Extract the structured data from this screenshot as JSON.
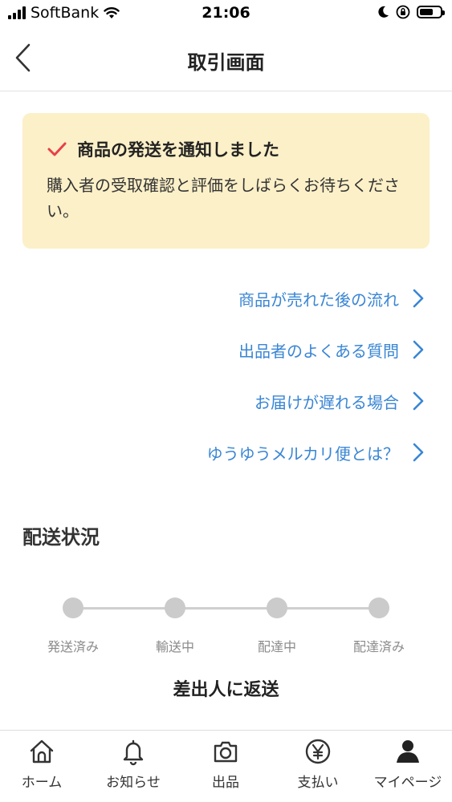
{
  "status_bar": {
    "carrier": "SoftBank",
    "time": "21:06"
  },
  "header": {
    "title": "取引画面"
  },
  "notice": {
    "title": "商品の発送を通知しました",
    "body": "購入者の受取確認と評価をしばらくお待ちください。"
  },
  "links": [
    {
      "label": "商品が売れた後の流れ"
    },
    {
      "label": "出品者のよくある質問"
    },
    {
      "label": "お届けが遅れる場合"
    },
    {
      "label": "ゆうゆうメルカリ便とは？"
    }
  ],
  "delivery": {
    "title": "配送状況",
    "steps": [
      {
        "label": "発送済み"
      },
      {
        "label": "輸送中"
      },
      {
        "label": "配達中"
      },
      {
        "label": "配達済み"
      }
    ],
    "return_text": "差出人に返送"
  },
  "tabbar": {
    "items": [
      {
        "label": "ホーム",
        "icon": "home-icon"
      },
      {
        "label": "お知らせ",
        "icon": "bell-icon"
      },
      {
        "label": "出品",
        "icon": "camera-icon"
      },
      {
        "label": "支払い",
        "icon": "yen-icon"
      },
      {
        "label": "マイページ",
        "icon": "person-icon"
      }
    ]
  },
  "colors": {
    "link": "#3a86d4",
    "notice_bg": "#fcf0c8",
    "check": "#e8404a",
    "step_inactive": "#cbcbcb"
  }
}
